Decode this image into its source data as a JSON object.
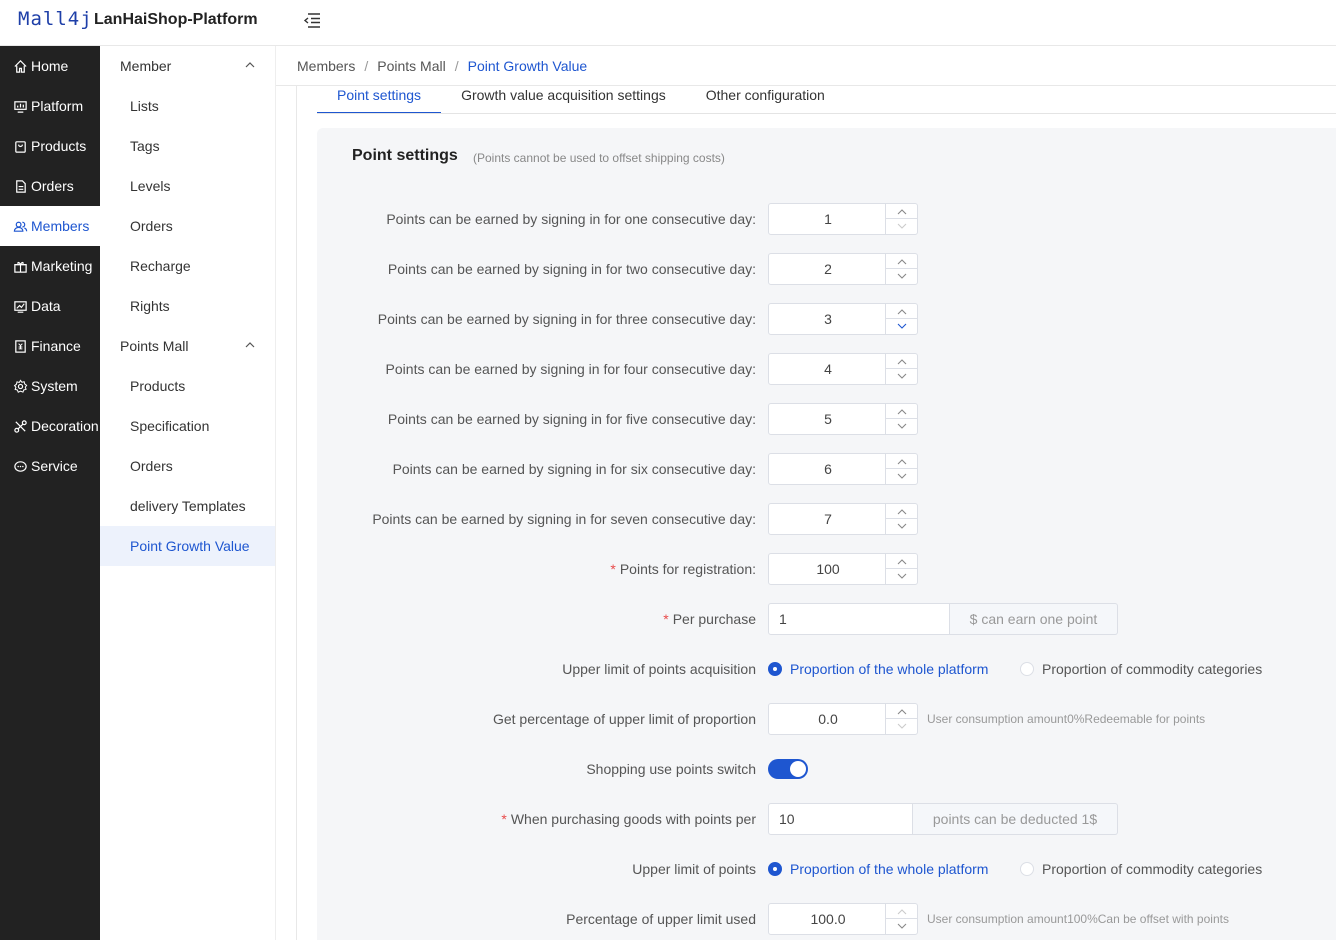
{
  "header": {
    "logo": "Mall4j",
    "title": "LanHaiShop-Platform"
  },
  "nav": [
    {
      "label": "Home",
      "icon": "home-icon"
    },
    {
      "label": "Platform",
      "icon": "monitor-icon"
    },
    {
      "label": "Products",
      "icon": "bag-icon"
    },
    {
      "label": "Orders",
      "icon": "document-icon"
    },
    {
      "label": "Members",
      "icon": "users-icon",
      "active": true
    },
    {
      "label": "Marketing",
      "icon": "gift-icon"
    },
    {
      "label": "Data",
      "icon": "chart-icon"
    },
    {
      "label": "Finance",
      "icon": "finance-icon"
    },
    {
      "label": "System",
      "icon": "gear-icon"
    },
    {
      "label": "Decoration",
      "icon": "decoration-icon"
    },
    {
      "label": "Service",
      "icon": "chat-icon"
    }
  ],
  "subnav": {
    "group1": {
      "label": "Member",
      "items": [
        "Lists",
        "Tags",
        "Levels",
        "Orders",
        "Recharge",
        "Rights"
      ]
    },
    "group2": {
      "label": "Points Mall",
      "items": [
        "Products",
        "Specification",
        "Orders",
        "delivery Templates",
        "Point Growth Value"
      ]
    }
  },
  "breadcrumb": {
    "items": [
      "Members",
      "Points Mall"
    ],
    "current": "Point Growth Value",
    "separator": "/"
  },
  "tabs": [
    "Point settings",
    "Growth value acquisition settings",
    "Other configuration"
  ],
  "panel": {
    "title": "Point settings",
    "note": "(Points cannot be used to offset shipping costs)",
    "signin_rows": [
      {
        "label": "Points can be earned by signing in for one consecutive day:",
        "value": "1"
      },
      {
        "label": "Points can be earned by signing in for two consecutive day:",
        "value": "2"
      },
      {
        "label": "Points can be earned by signing in for three consecutive day:",
        "value": "3"
      },
      {
        "label": "Points can be earned by signing in for four consecutive day:",
        "value": "4"
      },
      {
        "label": "Points can be earned by signing in for five consecutive day:",
        "value": "5"
      },
      {
        "label": "Points can be earned by signing in for six consecutive day:",
        "value": "6"
      },
      {
        "label": "Points can be earned by signing in for seven consecutive day:",
        "value": "7"
      }
    ],
    "registration": {
      "label": "Points for registration:",
      "value": "100"
    },
    "per_purchase": {
      "label": "Per purchase",
      "value": "1",
      "suffix": "$ can earn one point"
    },
    "upper_acq": {
      "label": "Upper limit of points acquisition",
      "opt1": "Proportion of the whole platform",
      "opt2": "Proportion of commodity categories"
    },
    "get_percentage": {
      "label": "Get percentage of upper limit of proportion",
      "value": "0.0",
      "hint": "User consumption amount0%Redeemable for points"
    },
    "switch": {
      "label": "Shopping use points switch",
      "on": true
    },
    "purchase_points": {
      "label": "When purchasing goods with points per",
      "value": "10",
      "suffix": "points can be deducted 1$"
    },
    "upper_points": {
      "label": "Upper limit of points",
      "opt1": "Proportion of the whole platform",
      "opt2": "Proportion of commodity categories"
    },
    "used_percentage": {
      "label": "Percentage of upper limit used",
      "value": "100.0",
      "hint": "User consumption amount100%Can be offset with points"
    }
  },
  "colors": {
    "accent": "#1e56d0",
    "nav_bg": "#222222",
    "panel_bg": "#f5f6f8",
    "required": "#e84a4a"
  }
}
